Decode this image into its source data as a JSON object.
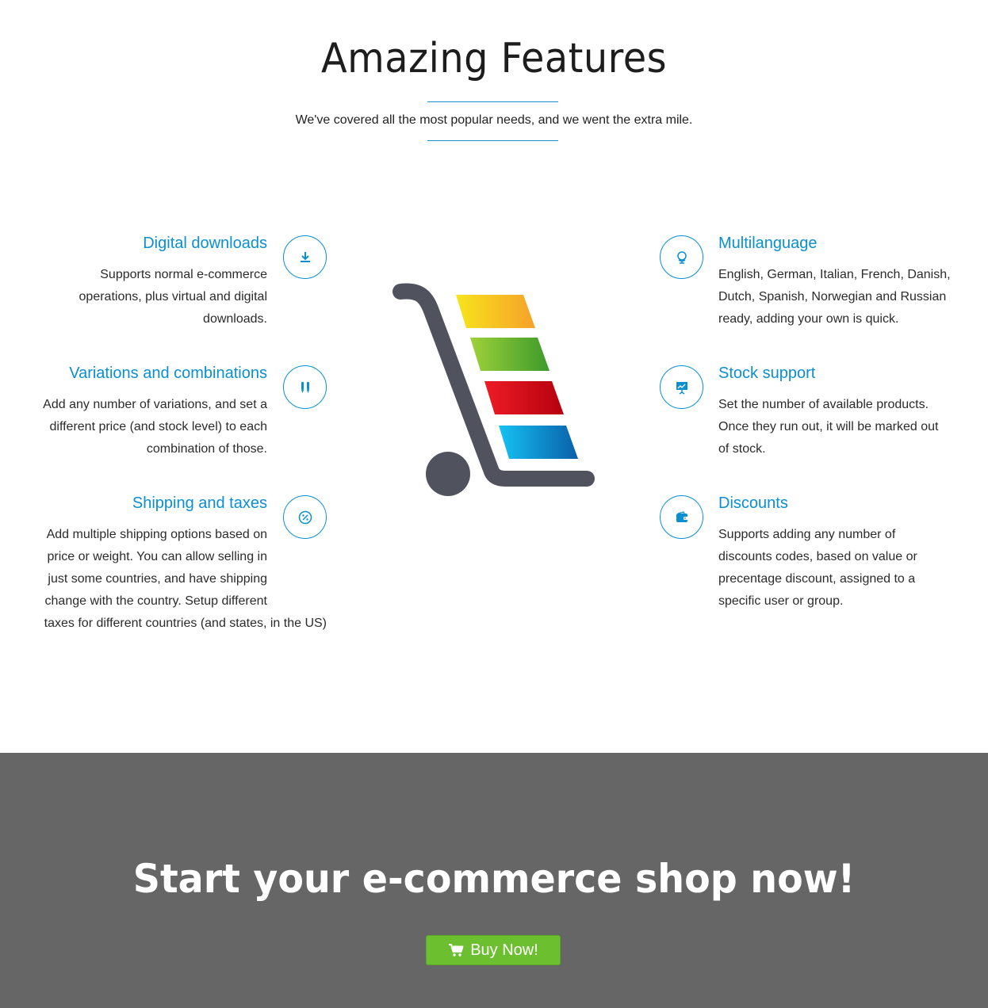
{
  "header": {
    "title": "Amazing Features",
    "subtitle": "We've covered all the most popular needs, and we went the extra mile."
  },
  "features_left": [
    {
      "title": "Digital downloads",
      "lines": [
        "Supports normal e-commerce",
        "operations, plus virtual and digital",
        "downloads."
      ],
      "icon": "download-icon"
    },
    {
      "title": "Variations and combinations",
      "lines": [
        "Add any number of variations, and set a",
        "different price (and stock level) to each",
        "combination of those."
      ],
      "icon": "pencils-icon"
    },
    {
      "title": "Shipping and taxes",
      "lines": [
        "Add multiple shipping options based on",
        "price or weight. You can allow selling in",
        "just some countries, and have shipping",
        "change with the country. Setup different",
        "taxes for different countries (and states, in the US)"
      ],
      "icon": "percent-icon"
    }
  ],
  "features_right": [
    {
      "title": "Multilanguage",
      "lines": [
        "English, German, Italian, French, Danish,",
        "Dutch, Spanish, Norwegian and Russian",
        "ready, adding your own is quick."
      ],
      "icon": "globe-icon"
    },
    {
      "title": "Stock support",
      "lines": [
        "Set the number of available products.",
        "Once they run out, it will be marked out",
        "of stock."
      ],
      "icon": "presentation-chart-icon"
    },
    {
      "title": "Discounts",
      "lines": [
        "Supports adding any number of",
        "discounts codes, based on value or",
        "precentage discount, assigned to a",
        "specific user or group."
      ],
      "icon": "wallet-icon"
    }
  ],
  "cta": {
    "title": "Start your e-commerce shop now!",
    "button_label": "Buy Now!",
    "button_icon": "cart-icon"
  },
  "colors": {
    "accent": "#0a8fd3",
    "cta_background": "#666666",
    "button": "#6cbf2f"
  }
}
